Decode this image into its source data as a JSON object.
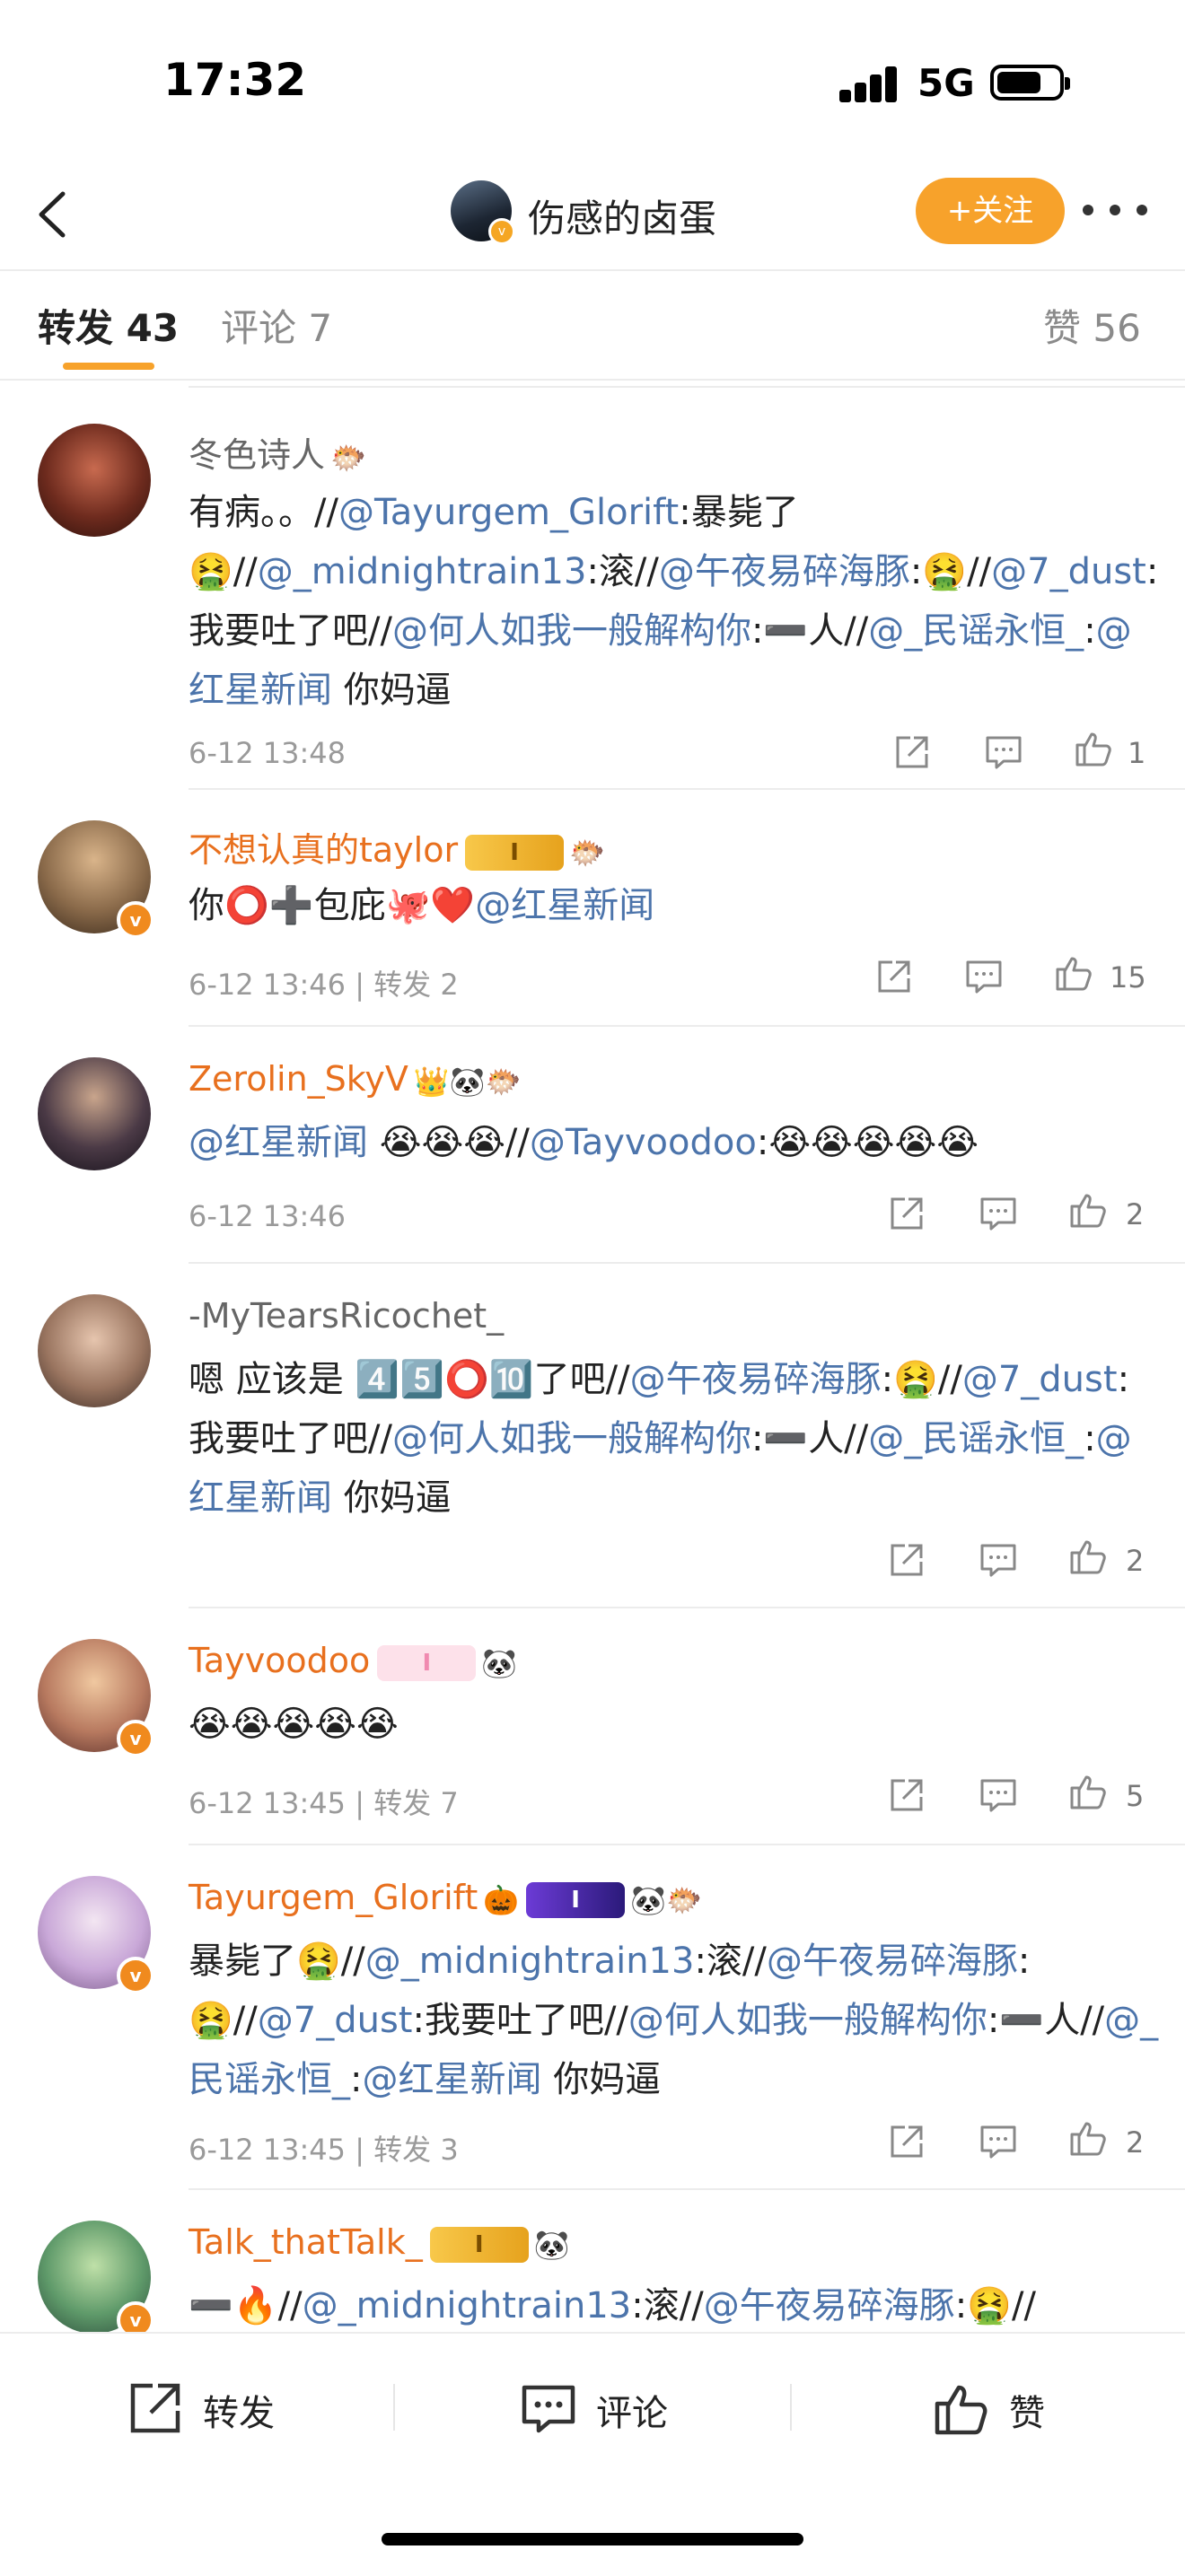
{
  "status": {
    "time": "17:32",
    "network": "5G"
  },
  "nav": {
    "title": "伤感的卤蛋",
    "follow_label": "+关注"
  },
  "tabs": {
    "repost": "转发 43",
    "comment": "评论 7",
    "like": "赞 56"
  },
  "items": [
    {
      "user": "冬色诗人",
      "body_parts": [
        "有病。。//",
        "@Tayurgem_Glorift",
        ":暴毙了🤮//",
        "@_midnightrain13",
        ":滚//",
        "@午夜易碎海豚",
        ":🤮//",
        "@7_dust",
        ":我要吐了吧//",
        "@何人如我一般解构你",
        ":➖人//",
        "@_民谣永恒_",
        ":",
        "@红星新闻",
        " 你妈逼"
      ],
      "time": "6-12 13:48",
      "likes": "1"
    },
    {
      "user": "不想认真的taylor",
      "vip": "I",
      "body_parts": [
        "你⭕➕包庇🐙❤️",
        "@红星新闻"
      ],
      "time": "6-12 13:46 | 转发 2",
      "likes": "15"
    },
    {
      "user": "Zerolin_SkyV",
      "body_parts": [
        "@红星新闻",
        " 😭😭😭//",
        "@Tayvoodoo",
        ":😭😭😭😭😭"
      ],
      "time": "6-12 13:46",
      "likes": "2"
    },
    {
      "user": "-MyTearsRicochet_",
      "body_parts": [
        "嗯 应该是 4️⃣5️⃣⭕🔟了吧//",
        "@午夜易碎海豚",
        ":🤮//",
        "@7_dust",
        ":我要吐了吧//",
        "@何人如我一般解构你",
        ":➖人//",
        "@_民谣永恒_",
        ":",
        "@红星新闻",
        " 你妈逼"
      ],
      "time": "",
      "likes": "2"
    },
    {
      "user": "Tayvoodoo",
      "vip": "I",
      "body_parts": [
        "😭😭😭😭😭"
      ],
      "time": "6-12 13:45 | 转发 7",
      "likes": "5"
    },
    {
      "user": "Tayurgem_Glorift",
      "vip": "I",
      "body_parts": [
        "暴毙了🤮//",
        "@_midnightrain13",
        ":滚//",
        "@午夜易碎海豚",
        ":🤮//",
        "@7_dust",
        ":我要吐了吧//",
        "@何人如我一般解构你",
        ":➖人//",
        "@_民谣永恒_",
        ":",
        "@红星新闻",
        " 你妈逼"
      ],
      "time": "6-12 13:45 | 转发 3",
      "likes": "2"
    },
    {
      "user": "Talk_thatTalk_",
      "vip": "I",
      "body_parts": [
        "➖🔥//",
        "@_midnightrain13",
        ":滚//",
        "@午夜易碎海豚",
        ":🤮//"
      ]
    }
  ],
  "bottom": {
    "repost": "转发",
    "comment": "评论",
    "like": "赞"
  },
  "colors": {
    "accent": "#f7a22b",
    "link": "#4c74ab",
    "username": "#e8701e"
  }
}
